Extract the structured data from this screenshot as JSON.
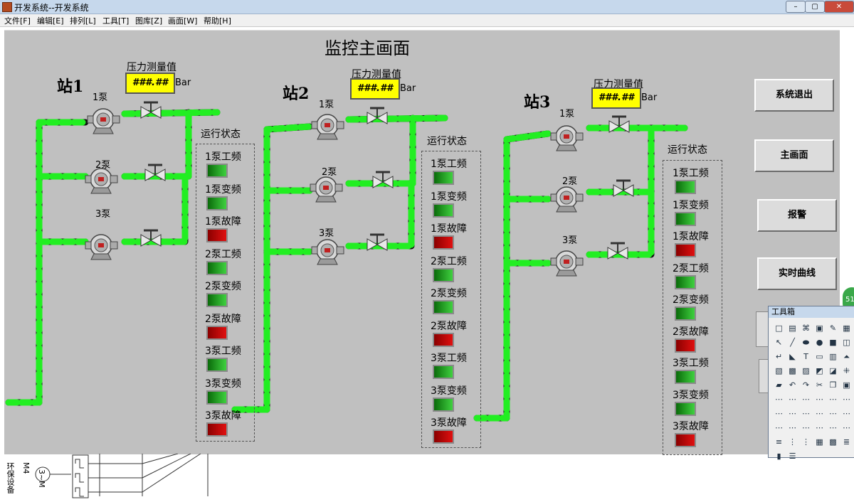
{
  "window": {
    "title": "开发系统--开发系统"
  },
  "menu": [
    "文件[F]",
    "编辑[E]",
    "排列[L]",
    "工具[T]",
    "图库[Z]",
    "画面[W]",
    "帮助[H]"
  ],
  "main_title": "监控主画面",
  "stations": [
    {
      "name": "站1",
      "pressure_label": "压力测量值",
      "pressure_value": "###.##",
      "unit": "Bar",
      "pumps": [
        "1泵",
        "2泵",
        "3泵"
      ],
      "status_title": "运行状态",
      "status": [
        {
          "label": "1泵工频",
          "color": "green"
        },
        {
          "label": "1泵变频",
          "color": "green"
        },
        {
          "label": "1泵故障",
          "color": "red"
        },
        {
          "label": "2泵工频",
          "color": "green"
        },
        {
          "label": "2泵变频",
          "color": "green"
        },
        {
          "label": "2泵故障",
          "color": "red"
        },
        {
          "label": "3泵工频",
          "color": "green"
        },
        {
          "label": "3泵变频",
          "color": "green"
        },
        {
          "label": "3泵故障",
          "color": "red"
        }
      ]
    },
    {
      "name": "站2",
      "pressure_label": "压力测量值",
      "pressure_value": "###.##",
      "unit": "Bar",
      "pumps": [
        "1泵",
        "2泵",
        "3泵"
      ],
      "status_title": "运行状态",
      "status": [
        {
          "label": "1泵工频",
          "color": "green"
        },
        {
          "label": "1泵变频",
          "color": "green"
        },
        {
          "label": "1泵故障",
          "color": "red"
        },
        {
          "label": "2泵工频",
          "color": "green"
        },
        {
          "label": "2泵变频",
          "color": "green"
        },
        {
          "label": "2泵故障",
          "color": "red"
        },
        {
          "label": "3泵工频",
          "color": "green"
        },
        {
          "label": "3泵变频",
          "color": "green"
        },
        {
          "label": "3泵故障",
          "color": "red"
        }
      ]
    },
    {
      "name": "站3",
      "pressure_label": "压力测量值",
      "pressure_value": "###.##",
      "unit": "Bar",
      "pumps": [
        "1泵",
        "2泵",
        "3泵"
      ],
      "status_title": "运行状态",
      "status": [
        {
          "label": "1泵工频",
          "color": "green"
        },
        {
          "label": "1泵变频",
          "color": "green"
        },
        {
          "label": "1泵故障",
          "color": "red"
        },
        {
          "label": "2泵工频",
          "color": "green"
        },
        {
          "label": "2泵变频",
          "color": "green"
        },
        {
          "label": "2泵故障",
          "color": "red"
        },
        {
          "label": "3泵工频",
          "color": "green"
        },
        {
          "label": "3泵变频",
          "color": "green"
        },
        {
          "label": "3泵故障",
          "color": "red"
        }
      ]
    }
  ],
  "buttons": {
    "exit": "系统退出",
    "main": "主画面",
    "alarm": "报警",
    "trend": "实时曲线"
  },
  "toolbox": {
    "title": "工具箱"
  },
  "badge": "51",
  "schematic": {
    "label_a": "环保设备",
    "label_b": "M4",
    "label_c": "3~M"
  },
  "colors": {
    "pipe_green": "#22ee22",
    "pipe_dark": "#000000",
    "canvas": "#c0c0c0",
    "display_yellow": "#ffff00"
  }
}
